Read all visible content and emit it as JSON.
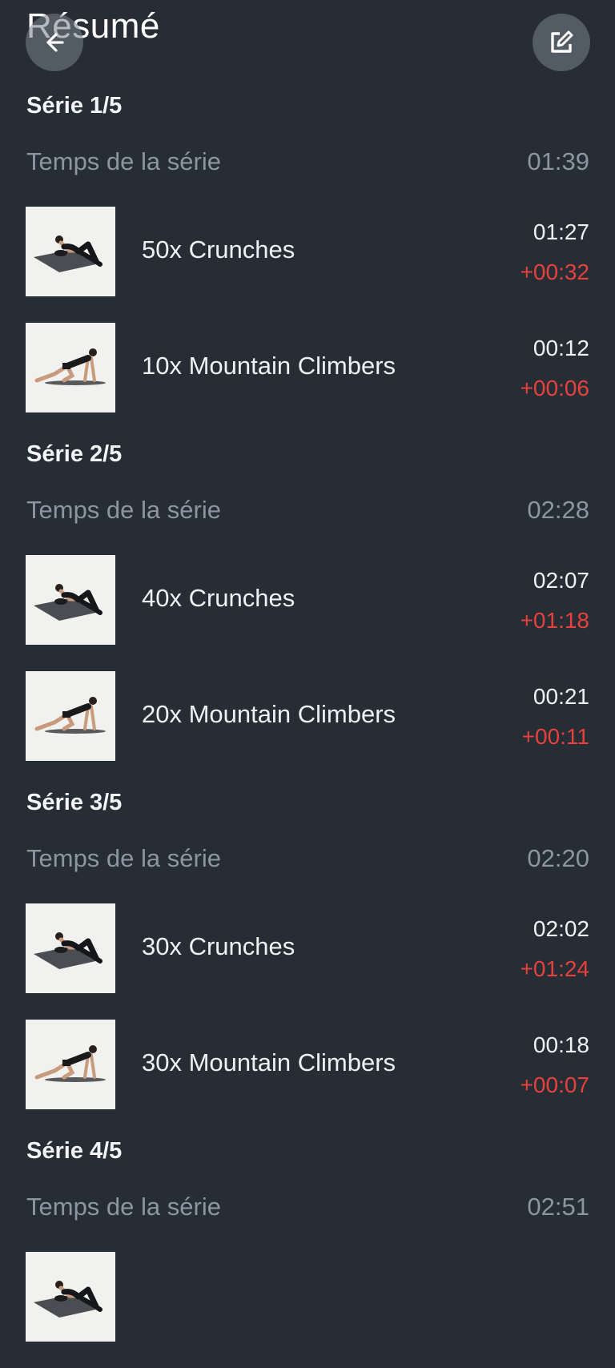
{
  "header": {
    "title": "Résumé",
    "back_icon": "arrow-left-icon",
    "edit_icon": "edit-icon"
  },
  "colors": {
    "background": "#262d34",
    "muted": "#8a97a2",
    "delta": "#e8403d"
  },
  "series": [
    {
      "label": "Série 1/5",
      "time_label": "Temps de la série",
      "time_value": "01:39",
      "exercises": [
        {
          "name": "50x Crunches",
          "time": "01:27",
          "delta": "+00:32",
          "image": "crunches"
        },
        {
          "name": "10x Mountain Climbers",
          "time": "00:12",
          "delta": "+00:06",
          "image": "mountain-climbers"
        }
      ]
    },
    {
      "label": "Série 2/5",
      "time_label": "Temps de la série",
      "time_value": "02:28",
      "exercises": [
        {
          "name": "40x Crunches",
          "time": "02:07",
          "delta": "+01:18",
          "image": "crunches"
        },
        {
          "name": "20x Mountain Climbers",
          "time": "00:21",
          "delta": "+00:11",
          "image": "mountain-climbers"
        }
      ]
    },
    {
      "label": "Série 3/5",
      "time_label": "Temps de la série",
      "time_value": "02:20",
      "exercises": [
        {
          "name": "30x Crunches",
          "time": "02:02",
          "delta": "+01:24",
          "image": "crunches"
        },
        {
          "name": "30x Mountain Climbers",
          "time": "00:18",
          "delta": "+00:07",
          "image": "mountain-climbers"
        }
      ]
    },
    {
      "label": "Série 4/5",
      "time_label": "Temps de la série",
      "time_value": "02:51",
      "exercises": [
        {
          "name": "",
          "time": "",
          "delta": "",
          "image": "crunches"
        }
      ]
    }
  ]
}
